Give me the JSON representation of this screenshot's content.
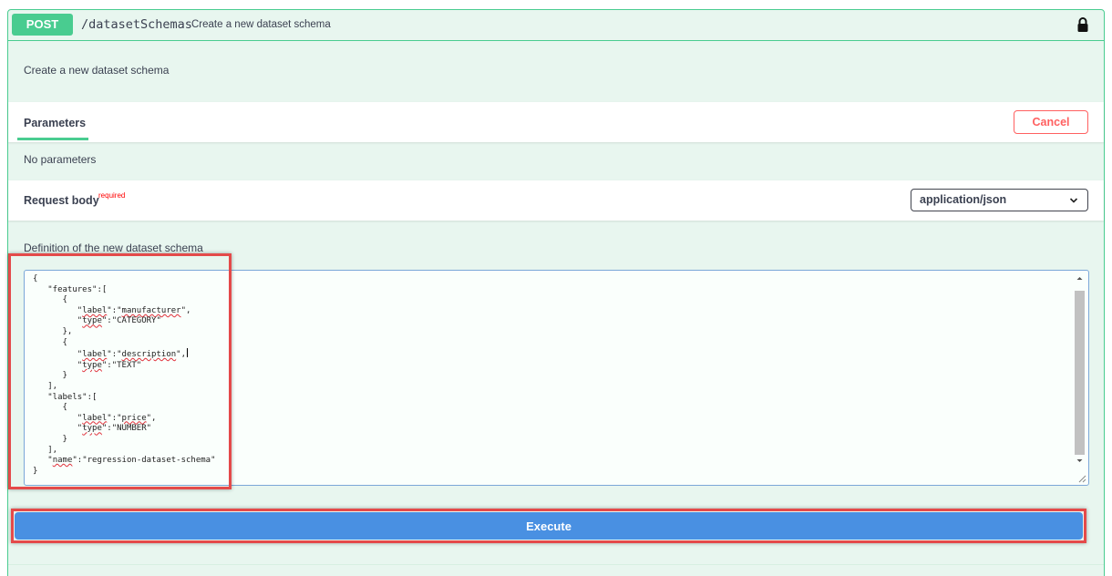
{
  "operation": {
    "method": "POST",
    "path": "/datasetSchemas",
    "summary": "Create a new dataset schema",
    "description": "Create a new dataset schema",
    "method_color": "#49cc90",
    "lock_icon": "lock-icon"
  },
  "parameters": {
    "tab_label": "Parameters",
    "cancel_label": "Cancel",
    "empty_text": "No parameters"
  },
  "request_body": {
    "label": "Request body",
    "required_label": "required",
    "content_type": "application/json",
    "description": "Definition of the new dataset schema",
    "json_lines": [
      [
        "{"
      ],
      [
        "   \"features\":["
      ],
      [
        "      {"
      ],
      [
        "         \"",
        {
          "t": "label",
          "s": 1
        },
        "\":\"",
        {
          "t": "manufacturer",
          "s": 1
        },
        "\","
      ],
      [
        "         \"",
        {
          "t": "type",
          "s": 1
        },
        "\":\"CATEGORY\""
      ],
      [
        "      },"
      ],
      [
        "      {"
      ],
      [
        "         \"",
        {
          "t": "label",
          "s": 1
        },
        "\":\"",
        {
          "t": "description",
          "s": 1
        },
        "\",",
        {
          "caret": 1
        }
      ],
      [
        "         \"",
        {
          "t": "type",
          "s": 1
        },
        "\":\"TEXT\""
      ],
      [
        "      }"
      ],
      [
        "   ],"
      ],
      [
        "   \"labels\":["
      ],
      [
        "      {"
      ],
      [
        "         \"",
        {
          "t": "label",
          "s": 1
        },
        "\":\"",
        {
          "t": "price",
          "s": 1
        },
        "\","
      ],
      [
        "         \"",
        {
          "t": "type",
          "s": 1
        },
        "\":\"NUMBER\""
      ],
      [
        "      }"
      ],
      [
        "   ],"
      ],
      [
        "   \"",
        {
          "t": "name",
          "s": 1
        },
        "\":\"regression-dataset-schema\""
      ],
      [
        "}"
      ]
    ]
  },
  "actions": {
    "execute_label": "Execute"
  },
  "colors": {
    "post_green": "#49cc90",
    "cancel_red": "#ff6060",
    "execute_blue": "#4990e2",
    "highlight_red": "#e44a4a"
  }
}
